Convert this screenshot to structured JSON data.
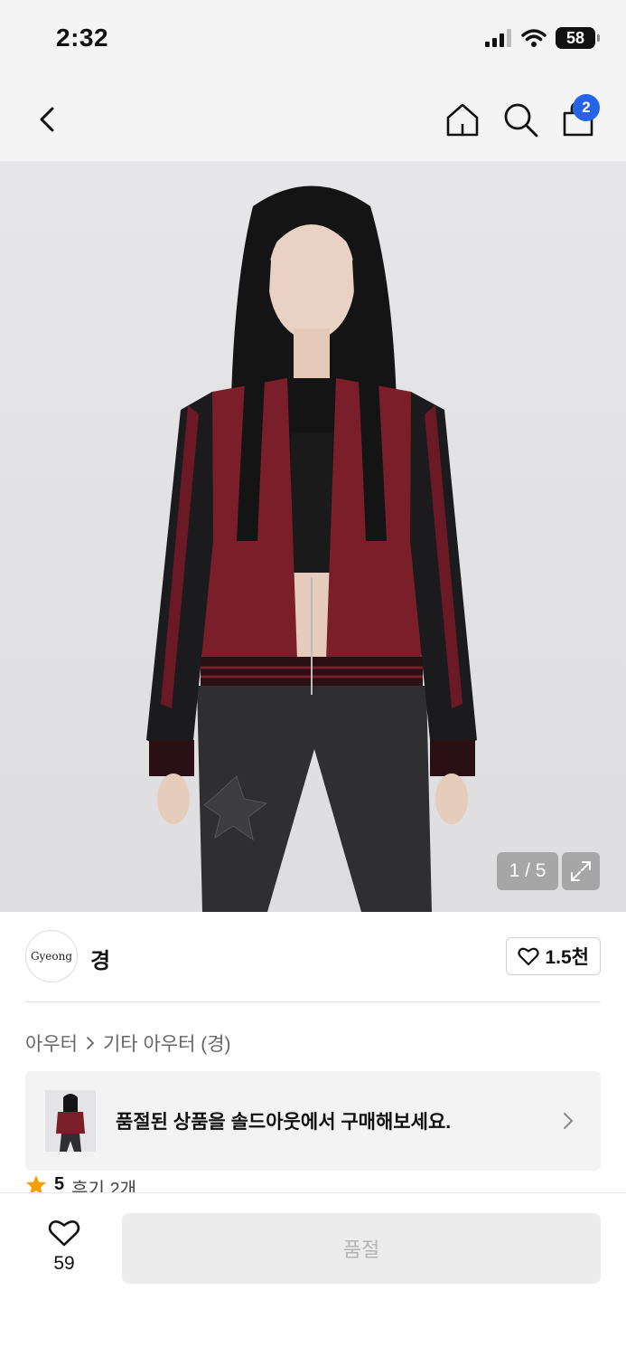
{
  "status_bar": {
    "time": "2:32",
    "battery": "58"
  },
  "nav": {
    "cart_count": "2"
  },
  "gallery": {
    "counter": "1 / 5"
  },
  "brand": {
    "logo_text": "Gyeong",
    "name": "경",
    "likes": "1.5천"
  },
  "breadcrumb": {
    "items": [
      "아우터",
      "기타 아우터 (경)"
    ]
  },
  "soldout_banner": {
    "message": "품절된 상품을 솔드아웃에서 구매해보세요."
  },
  "reviews": {
    "score": "5",
    "label": "후기 2개"
  },
  "bottom_bar": {
    "wish_count": "59",
    "buy_label": "품절"
  },
  "colors": {
    "accent": "#2563eb",
    "star": "#f59e0b",
    "jacket": "#7a1e2a"
  }
}
